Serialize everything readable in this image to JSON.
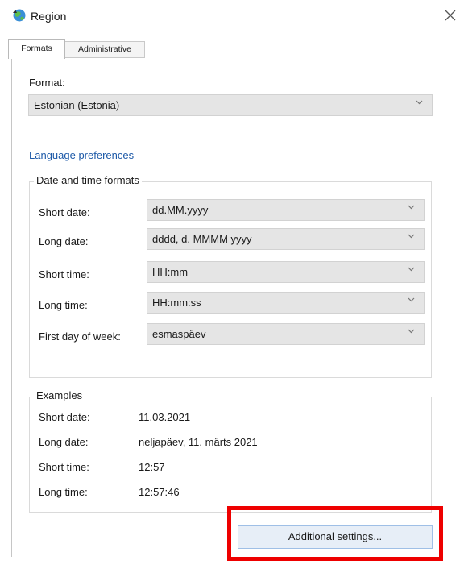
{
  "window": {
    "title": "Region",
    "close_icon": "close-icon"
  },
  "tabs": [
    {
      "label": "Formats",
      "active": true
    },
    {
      "label": "Administrative",
      "active": false
    }
  ],
  "format": {
    "label": "Format:",
    "value": "Estonian (Estonia)"
  },
  "language_link": "Language preferences",
  "date_time_formats": {
    "title": "Date and time formats",
    "rows": [
      {
        "label": "Short date:",
        "value": "dd.MM.yyyy"
      },
      {
        "label": "Long date:",
        "value": "dddd, d. MMMM yyyy"
      },
      {
        "label": "Short time:",
        "value": "HH:mm"
      },
      {
        "label": "Long time:",
        "value": "HH:mm:ss"
      },
      {
        "label": "First day of week:",
        "value": "esmaspäev"
      }
    ]
  },
  "examples": {
    "title": "Examples",
    "rows": [
      {
        "label": "Short date:",
        "value": "11.03.2021"
      },
      {
        "label": "Long date:",
        "value": "neljapäev, 11. märts 2021"
      },
      {
        "label": "Short time:",
        "value": "12:57"
      },
      {
        "label": "Long time:",
        "value": "12:57:46"
      }
    ]
  },
  "additional_button": "Additional settings...",
  "colors": {
    "highlight": "#ee0000",
    "link": "#1e5aa8",
    "combo_bg": "#e5e5e5",
    "button_bg": "#e7eef7"
  }
}
